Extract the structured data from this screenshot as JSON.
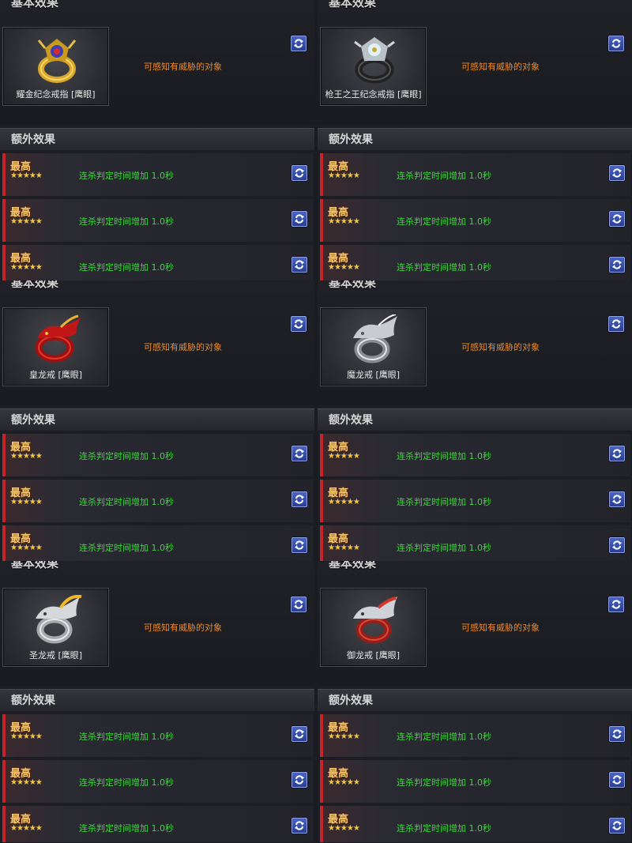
{
  "labels": {
    "basic_header": "基本效果",
    "extra_header": "额外效果",
    "basic_effect": "可感知有威胁的对象",
    "extra_tier": "最高",
    "extra_stars": "★★★★★",
    "extra_effect": "连杀判定时间增加 1.0秒"
  },
  "items": [
    {
      "name": "耀金纪念戒指 [鹰眼]",
      "icon": "gold-ring-icon"
    },
    {
      "name": "枪王之王纪念戒指 [鹰眼]",
      "icon": "silver-ring-icon"
    },
    {
      "name": "皇龙戒 [鹰眼]",
      "icon": "red-dragon-ring-icon"
    },
    {
      "name": "魔龙戒 [鹰眼]",
      "icon": "silver-dragon-ring-icon"
    },
    {
      "name": "圣龙戒 [鹰眼]",
      "icon": "gold-dragon-ring-icon"
    },
    {
      "name": "御龙戒 [鹰眼]",
      "icon": "crimson-dragon-ring-icon"
    }
  ],
  "colors": {
    "accent_orange": "#e98a2a",
    "effect_green": "#3ed63e",
    "tier_bar_red": "#c4242a",
    "refresh_blue": "#3a54b0"
  }
}
